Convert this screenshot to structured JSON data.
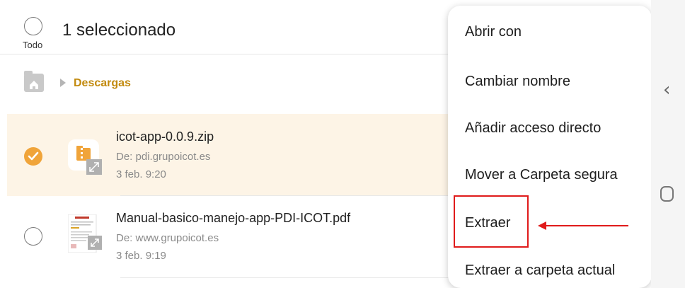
{
  "header": {
    "select_all_label": "Todo",
    "title": "1 seleccionado"
  },
  "breadcrumb": {
    "home_icon": "home-folder-icon",
    "folder": "Descargas"
  },
  "files": [
    {
      "name": "icot-app-0.0.9.zip",
      "source": "De: pdi.grupoicot.es",
      "date": "3 feb. 9:20",
      "selected": true,
      "icon": "zip-archive-icon"
    },
    {
      "name": "Manual-basico-manejo-app-PDI-ICOT.pdf",
      "source": "De: www.grupoicot.es",
      "date": "3 feb. 9:19",
      "selected": false,
      "icon": "pdf-thumbnail-icon"
    }
  ],
  "menu": {
    "items": [
      "Abrir con",
      "Cambiar nombre",
      "Añadir acceso directo",
      "Mover a Carpeta segura",
      "Extraer",
      "Extraer a carpeta actual"
    ]
  },
  "nav": {
    "back_icon": "back-chevron-icon",
    "home_icon": "home-button-icon"
  },
  "colors": {
    "accent": "#f0a43a",
    "breadcrumb": "#c28a0e",
    "selected_row": "#fdf4e6",
    "annotation": "#e01b1b"
  }
}
